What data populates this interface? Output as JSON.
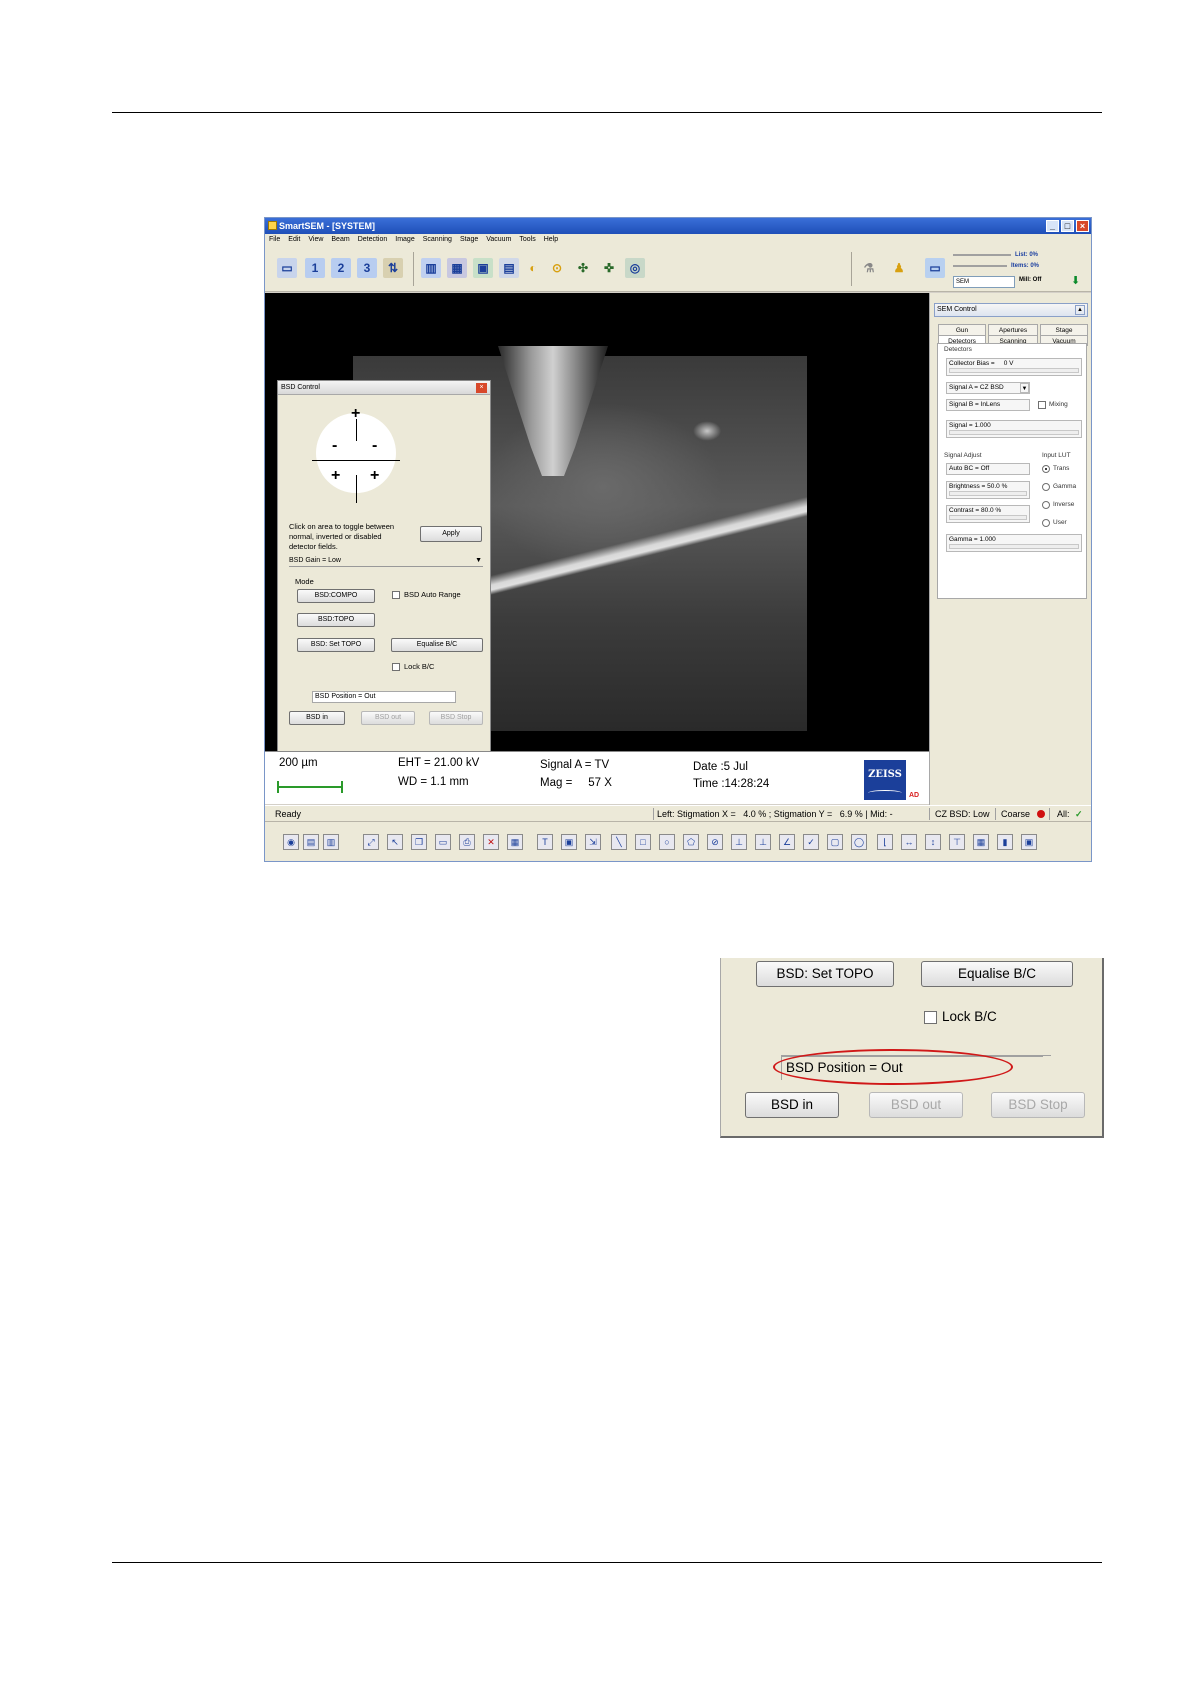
{
  "window": {
    "title": "SmartSEM - [SYSTEM]",
    "menu": [
      "File",
      "Edit",
      "View",
      "Beam",
      "Detection",
      "Image",
      "Scanning",
      "Stage",
      "Vacuum",
      "Tools",
      "Help"
    ]
  },
  "top_status": {
    "list": "List: 0%",
    "items": "Items: 0%",
    "mode_select": "SEM",
    "mill": "Mill: Off"
  },
  "bsd_control": {
    "title": "BSD Control",
    "detector_symbols": [
      "+",
      "-",
      "-",
      "+",
      "+"
    ],
    "hint": "Click on area to toggle between normal, inverted or disabled detector fields.",
    "apply_label": "Apply",
    "gain_select": "BSD Gain = Low",
    "mode_label": "Mode",
    "compo_label": "BSD:COMPO",
    "topo_label": "BSD:TOPO",
    "set_topo_label": "BSD: Set TOPO",
    "auto_range_label": "BSD Auto Range",
    "equalise_label": "Equalise B/C",
    "lock_bc_label": "Lock B/C",
    "position_field": "BSD Position = Out",
    "bsd_in_label": "BSD in",
    "bsd_out_label": "BSD out",
    "bsd_stop_label": "BSD Stop"
  },
  "infobar": {
    "scale": "200 µm",
    "eht": "EHT = 21.00 kV",
    "wd": "WD =  1.1 mm",
    "signal": "Signal A = TV",
    "mag": "Mag =     57 X",
    "date": "Date :5 Jul",
    "time": "Time :14:28:24",
    "logo_text": "ZEISS",
    "logo_small": "AD"
  },
  "sem_control": {
    "title": "SEM Control",
    "tabs_row1": [
      "Gun",
      "Apertures",
      "Stage"
    ],
    "tabs_row2": [
      "Detectors",
      "Scanning",
      "Vacuum"
    ],
    "detectors_label": "Detectors",
    "collector_bias": "Collector Bias =     0 V",
    "signal_a": "Signal A = CZ BSD",
    "signal_b": "Signal B = InLens",
    "mixing_label": "Mixing",
    "signal_value": "Signal = 1.000",
    "signal_adjust_label": "Signal Adjust",
    "input_lut_label": "Input LUT",
    "auto_bc": "Auto BC = Off",
    "brightness": "Brightness = 50.0 %",
    "contrast": "Contrast = 80.0 %",
    "gamma": "Gamma = 1.000",
    "lut_options": [
      "Trans",
      "Gamma",
      "Inverse",
      "User"
    ],
    "lut_selected": 0
  },
  "statusbar": {
    "ready": "Ready",
    "stigmation": "Left: Stigmation X =   4.0 % ; Stigmation Y =   6.9 % | Mid: -",
    "cz_bsd": "CZ BSD: Low",
    "coarse": "Coarse",
    "all": "All:"
  },
  "crop": {
    "set_topo_label": "BSD: Set TOPO",
    "equalise_label": "Equalise B/C",
    "lock_bc_label": "Lock B/C",
    "position_field": "BSD Position = Out",
    "bsd_in_label": "BSD in",
    "bsd_out_label": "BSD out",
    "bsd_stop_label": "BSD Stop"
  },
  "colors": {
    "title_bar": "#1f4fb8",
    "highlight_ellipse": "#d01818",
    "scale_bar": "#2a9a2a",
    "zeiss_blue": "#1b3f9a"
  }
}
